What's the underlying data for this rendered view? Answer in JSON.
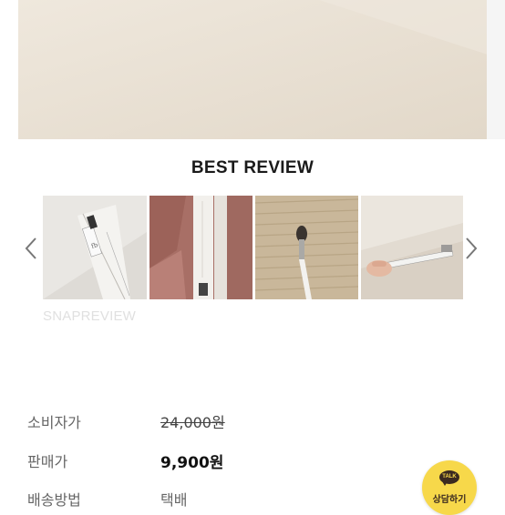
{
  "section": {
    "title": "BEST REVIEW"
  },
  "carousel": {
    "prev_icon": "chevron-left-icon",
    "next_icon": "chevron-right-icon",
    "thumbnails": [
      {
        "kind": "brush-on-box-photo"
      },
      {
        "kind": "brush-package-pink-photo"
      },
      {
        "kind": "brush-on-wood-photo"
      },
      {
        "kind": "brush-in-hand-photo"
      }
    ],
    "watermark": "SNAPREVIEW"
  },
  "product_info": {
    "list_price_label": "소비자가",
    "list_price": "24,000원",
    "sale_price_label": "판매가",
    "sale_price": "9,900원",
    "shipping_label": "배송방법",
    "shipping_value": "택배"
  },
  "chat_button": {
    "badge": "TALK",
    "label": "상담하기",
    "color": "#f7d84a"
  }
}
